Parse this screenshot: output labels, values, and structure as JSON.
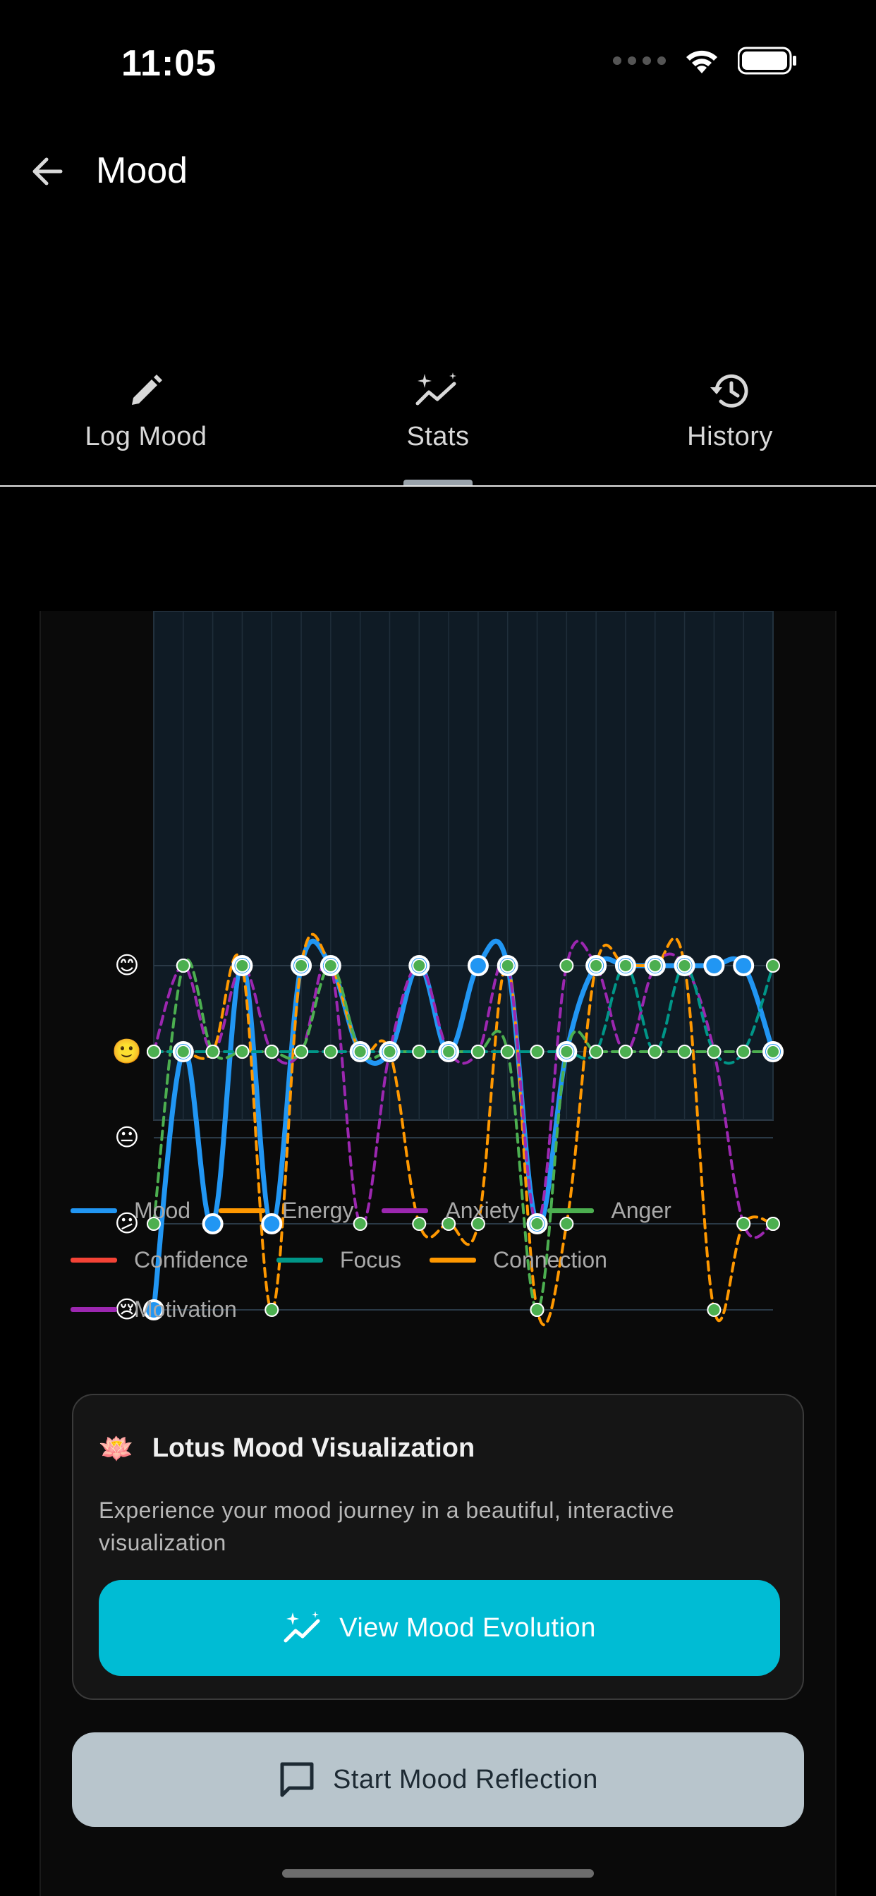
{
  "status_bar": {
    "time": "11:05",
    "icons": [
      "signal-dots-icon",
      "wifi-icon",
      "battery-icon"
    ]
  },
  "header": {
    "title": "Mood",
    "back_icon": "arrow-left-icon"
  },
  "tabs": [
    {
      "label": "Log Mood",
      "icon": "pencil-icon",
      "active": false
    },
    {
      "label": "Stats",
      "icon": "trending-sparkle-icon",
      "active": true
    },
    {
      "label": "History",
      "icon": "history-icon",
      "active": false
    }
  ],
  "chart": {
    "y_emojis": [
      "😊",
      "🙂",
      "😐",
      "😕",
      "😢"
    ]
  },
  "chart_data": {
    "type": "line",
    "x": [
      1,
      2,
      3,
      4,
      5,
      6,
      7,
      8,
      9,
      10,
      11,
      12,
      13,
      14,
      15,
      16,
      17,
      18,
      19,
      20,
      21,
      22
    ],
    "ylim": [
      1,
      5
    ],
    "y_tick_labels": [
      "😢",
      "😕",
      "😐",
      "🙂",
      "😊"
    ],
    "grid": true,
    "legend_placement": "bottom",
    "series": [
      {
        "name": "Mood",
        "color": "#2196f3",
        "dashed": false,
        "values": [
          1,
          4,
          2,
          5,
          2,
          5,
          5,
          4,
          4,
          5,
          4,
          5,
          5,
          2,
          4,
          5,
          5,
          5,
          5,
          5,
          5,
          4
        ]
      },
      {
        "name": "Energy",
        "color": "#ff9800",
        "dashed": true,
        "values": [
          4,
          4,
          4,
          5,
          1,
          5,
          5,
          4,
          4,
          2,
          2,
          2,
          5,
          1,
          2,
          5,
          5,
          5,
          5,
          1,
          2,
          2
        ]
      },
      {
        "name": "Anxiety",
        "color": "#9c27b0",
        "dashed": true,
        "values": [
          4,
          5,
          4,
          5,
          4,
          4,
          5,
          2,
          4,
          5,
          4,
          4,
          5,
          2,
          5,
          5,
          4,
          5,
          5,
          4,
          2,
          2
        ]
      },
      {
        "name": "Anger",
        "color": "#4caf50",
        "dashed": true,
        "values": [
          2,
          5,
          4,
          4,
          4,
          4,
          5,
          4,
          4,
          4,
          4,
          4,
          4,
          1,
          4,
          4,
          4,
          4,
          4,
          4,
          4,
          4
        ]
      },
      {
        "name": "Confidence",
        "color": "#f44336",
        "dashed": false,
        "values": []
      },
      {
        "name": "Focus",
        "color": "#009688",
        "dashed": true,
        "values": [
          4,
          4,
          4,
          4,
          4,
          4,
          4,
          4,
          4,
          4,
          4,
          4,
          4,
          4,
          4,
          4,
          5,
          4,
          5,
          4,
          4,
          5
        ]
      },
      {
        "name": "Connection",
        "color": "#ff9800",
        "dashed": true,
        "values": []
      },
      {
        "name": "Motivation",
        "color": "#9c27b0",
        "dashed": true,
        "values": []
      }
    ]
  },
  "lotus_card": {
    "emoji": "🪷",
    "title": "Lotus Mood Visualization",
    "description": "Experience your mood journey in a beautiful, interactive visualization",
    "button_label": "View Mood Evolution"
  },
  "reflection_button": {
    "label": "Start Mood Reflection"
  }
}
